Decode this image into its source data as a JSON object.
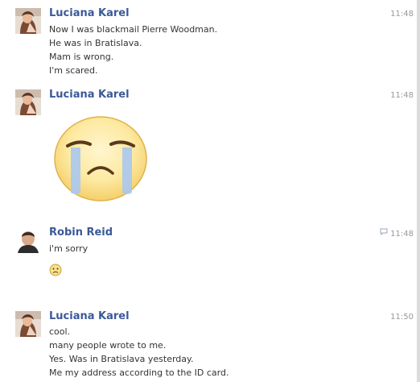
{
  "messages": [
    {
      "sender": "Luciana Karel",
      "time": "11:48",
      "lines": [
        "Now I was blackmail Pierre Woodman.",
        "He was in Bratislava.",
        "Mam is wrong.",
        "I'm scared."
      ]
    },
    {
      "sender": "Luciana Karel",
      "time": "11:48",
      "sticker": "crying-face-sticker"
    },
    {
      "sender": "Robin Reid",
      "time": "11:48",
      "seen_icon": "chat-bubble-icon",
      "lines": [
        "i'm sorry"
      ],
      "emoticon": "frown-emoticon"
    },
    {
      "sender": "Luciana Karel",
      "time": "11:50",
      "lines": [
        "cool.",
        "many people wrote to me.",
        "Yes. Was in Bratislava yesterday.",
        "Me my address according to the ID card."
      ]
    }
  ]
}
